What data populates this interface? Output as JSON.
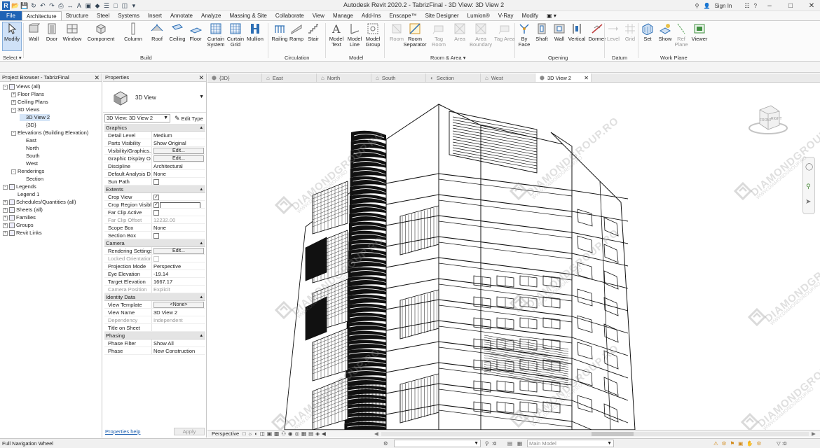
{
  "app": {
    "title": "Autodesk Revit 2020.2 - TabrizFinal - 3D View: 3D View 2",
    "sign_in": "Sign In"
  },
  "menu": {
    "tabs": [
      "File",
      "Architecture",
      "Structure",
      "Steel",
      "Systems",
      "Insert",
      "Annotate",
      "Analyze",
      "Massing & Site",
      "Collaborate",
      "View",
      "Manage",
      "Add-Ins",
      "Enscape™",
      "Site Designer",
      "Lumion®",
      "V-Ray",
      "Modify"
    ],
    "active": "Architecture"
  },
  "ribbon": {
    "modify": "Modify",
    "select": "Select ▾",
    "build": {
      "label": "Build",
      "buttons": [
        "Wall",
        "Door",
        "Window",
        "Component",
        "Column",
        "Roof",
        "Ceiling",
        "Floor",
        "Curtain System",
        "Curtain Grid",
        "Mullion"
      ]
    },
    "circulation": {
      "label": "Circulation",
      "buttons": [
        "Railing",
        "Ramp",
        "Stair"
      ]
    },
    "model": {
      "label": "Model",
      "buttons": [
        "Model Text",
        "Model Line",
        "Model Group"
      ]
    },
    "room_area": {
      "label": "Room & Area ▾",
      "buttons": [
        "Room",
        "Room Separator",
        "Tag Room",
        "Area",
        "Area Boundary",
        "Tag Area"
      ]
    },
    "opening": {
      "label": "Opening",
      "buttons": [
        "By Face",
        "Shaft",
        "Wall",
        "Vertical",
        "Dormer"
      ]
    },
    "datum": {
      "label": "Datum",
      "buttons": [
        "Level",
        "Grid"
      ]
    },
    "work_plane": {
      "label": "Work Plane",
      "buttons": [
        "Set",
        "Show",
        "Ref Plane",
        "Viewer"
      ]
    }
  },
  "browser": {
    "title": "Project Browser - TabrizFinal",
    "items": [
      {
        "label": "Views (all)",
        "indent": 0,
        "exp": "-"
      },
      {
        "label": "Floor Plans",
        "indent": 1,
        "exp": "+"
      },
      {
        "label": "Ceiling Plans",
        "indent": 1,
        "exp": "+"
      },
      {
        "label": "3D Views",
        "indent": 1,
        "exp": "-"
      },
      {
        "label": "3D View 2",
        "indent": 2,
        "exp": "",
        "sel": true
      },
      {
        "label": "{3D}",
        "indent": 2,
        "exp": ""
      },
      {
        "label": "Elevations (Building Elevation)",
        "indent": 1,
        "exp": "-"
      },
      {
        "label": "East",
        "indent": 2,
        "exp": ""
      },
      {
        "label": "North",
        "indent": 2,
        "exp": ""
      },
      {
        "label": "South",
        "indent": 2,
        "exp": ""
      },
      {
        "label": "West",
        "indent": 2,
        "exp": ""
      },
      {
        "label": "Renderings",
        "indent": 1,
        "exp": "-"
      },
      {
        "label": "Section",
        "indent": 2,
        "exp": ""
      },
      {
        "label": "Legends",
        "indent": 0,
        "exp": "-"
      },
      {
        "label": "Legend 1",
        "indent": 1,
        "exp": ""
      },
      {
        "label": "Schedules/Quantities (all)",
        "indent": 0,
        "exp": "+"
      },
      {
        "label": "Sheets (all)",
        "indent": 0,
        "exp": "+"
      },
      {
        "label": "Families",
        "indent": 0,
        "exp": "+"
      },
      {
        "label": "Groups",
        "indent": 0,
        "exp": "+"
      },
      {
        "label": "Revit Links",
        "indent": 0,
        "exp": "+"
      }
    ]
  },
  "properties": {
    "title": "Properties",
    "type_name": "3D View",
    "view_selector": "3D View: 3D View 2",
    "edit_type": "Edit Type",
    "groups": [
      {
        "name": "Graphics",
        "rows": [
          {
            "k": "Detail Level",
            "v": "Medium"
          },
          {
            "k": "Parts Visibility",
            "v": "Show Original"
          },
          {
            "k": "Visibility/Graphics...",
            "v": "Edit...",
            "btn": true
          },
          {
            "k": "Graphic Display O...",
            "v": "Edit...",
            "btn": true
          },
          {
            "k": "Discipline",
            "v": "Architectural"
          },
          {
            "k": "Default Analysis D...",
            "v": "None"
          },
          {
            "k": "Sun Path",
            "v": "",
            "cb": "off"
          }
        ]
      },
      {
        "name": "Extents",
        "rows": [
          {
            "k": "Crop View",
            "v": "",
            "cb": "on"
          },
          {
            "k": "Crop Region Visible",
            "v": "",
            "cb": "on"
          },
          {
            "k": "Far Clip Active",
            "v": "",
            "cb": "off"
          },
          {
            "k": "Far Clip Offset",
            "v": "12232.00",
            "dis": true
          },
          {
            "k": "Scope Box",
            "v": "None"
          },
          {
            "k": "Section Box",
            "v": "",
            "cb": "off"
          }
        ]
      },
      {
        "name": "Camera",
        "rows": [
          {
            "k": "Rendering Settings",
            "v": "Edit...",
            "btn": true
          },
          {
            "k": "Locked Orientation",
            "v": "",
            "dis": true,
            "cb": "off"
          },
          {
            "k": "Projection Mode",
            "v": "Perspective"
          },
          {
            "k": "Eye Elevation",
            "v": "-19.14"
          },
          {
            "k": "Target Elevation",
            "v": "1667.17"
          },
          {
            "k": "Camera Position",
            "v": "Explicit",
            "dis": true
          }
        ]
      },
      {
        "name": "Identity Data",
        "rows": [
          {
            "k": "View Template",
            "v": "<None>",
            "btn": true
          },
          {
            "k": "View Name",
            "v": "3D View 2"
          },
          {
            "k": "Dependency",
            "v": "Independent",
            "dis": true
          },
          {
            "k": "Title on Sheet",
            "v": ""
          }
        ]
      },
      {
        "name": "Phasing",
        "rows": [
          {
            "k": "Phase Filter",
            "v": "Show All"
          },
          {
            "k": "Phase",
            "v": "New Construction"
          }
        ]
      }
    ],
    "help_link": "Properties help",
    "apply": "Apply"
  },
  "view_tabs": [
    {
      "label": "{3D}",
      "active": false
    },
    {
      "label": "East",
      "active": false
    },
    {
      "label": "North",
      "active": false
    },
    {
      "label": "South",
      "active": false
    },
    {
      "label": "Section",
      "active": false
    },
    {
      "label": "West",
      "active": false
    },
    {
      "label": "3D View 2",
      "active": true
    }
  ],
  "viewcube": {
    "front": "FRONT",
    "right": "RIGHT"
  },
  "view_control": {
    "projection": "Perspective"
  },
  "status": {
    "left": "Full Navigation Wheel",
    "zero": ":0",
    "model": "Main Model"
  },
  "watermark": {
    "text": "DIAMONDGROUP.RO",
    "sub": "WWW.DIAMONDGROUP.RO"
  }
}
